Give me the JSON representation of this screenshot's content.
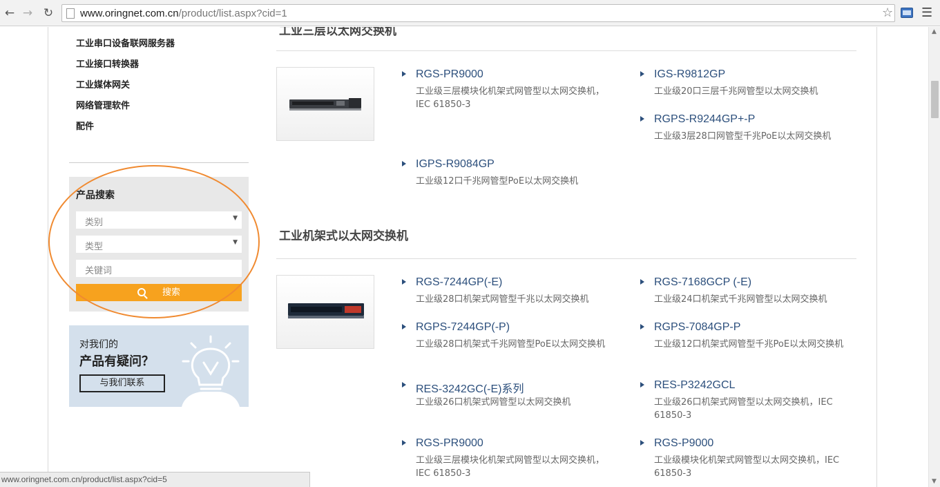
{
  "browser": {
    "url_host": "www.oringnet.com.cn",
    "url_path": "/product/list.aspx?cid=1",
    "status_url": "www.oringnet.com.cn/product/list.aspx?cid=5"
  },
  "sidebar": {
    "categories": [
      "工业串口设备联网服务器",
      "工业接口转换器",
      "工业媒体网关",
      "网络管理软件",
      "配件"
    ]
  },
  "search": {
    "title": "产品搜索",
    "category_placeholder": "类别",
    "type_placeholder": "类型",
    "keyword_placeholder": "关键词",
    "button_label": "搜索"
  },
  "contact": {
    "line1": "对我们的",
    "line2": "产品有疑问？",
    "button_label": "与我们联系"
  },
  "sections": [
    {
      "title": "工业三层以太网交换机",
      "products": [
        {
          "name": "RGS-PR9000",
          "desc": "工业级三层模块化机架式网管型以太网交换机，IEC 61850-3"
        },
        {
          "name": "IGS-R9812GP",
          "desc": "工业级20口三层千兆网管型以太网交换机"
        },
        {
          "name": "RGPS-R9244GP+-P",
          "desc": "工业级3层28口网管型千兆PoE以太网交换机"
        },
        {
          "name": "IGPS-R9084GP",
          "desc": "工业级12口千兆网管型PoE以太网交换机"
        }
      ]
    },
    {
      "title": "工业机架式以太网交换机",
      "products": [
        {
          "name": "RGS-7244GP(-E)",
          "desc": "工业级28口机架式网管型千兆以太网交换机"
        },
        {
          "name": "RGS-7168GCP (-E)",
          "desc": "工业级24口机架式千兆网管型以太网交换机"
        },
        {
          "name": "RGPS-7244GP(-P)",
          "desc": "工业级28口机架式千兆网管型PoE以太网交换机"
        },
        {
          "name": "RGPS-7084GP-P",
          "desc": "工业级12口机架式网管型千兆PoE以太网交换机"
        },
        {
          "name": "RES-3242GC(-E)系列",
          "desc": "工业级26口机架式网管型以太网交换机"
        },
        {
          "name": "RES-P3242GCL",
          "desc": "工业级26口机架式网管型以太网交换机，IEC 61850-3"
        },
        {
          "name": "RGS-PR9000",
          "desc": "工业级三层模块化机架式网管型以太网交换机，IEC 61850-3"
        },
        {
          "name": "RGS-P9000",
          "desc": "工业级模块化机架式网管型以太网交换机，IEC 61850-3"
        }
      ]
    }
  ],
  "colors": {
    "accent": "#f7a21e",
    "link": "#2c4f7c",
    "highlight": "#f08a30",
    "contact_bg": "#d4e0ec"
  }
}
